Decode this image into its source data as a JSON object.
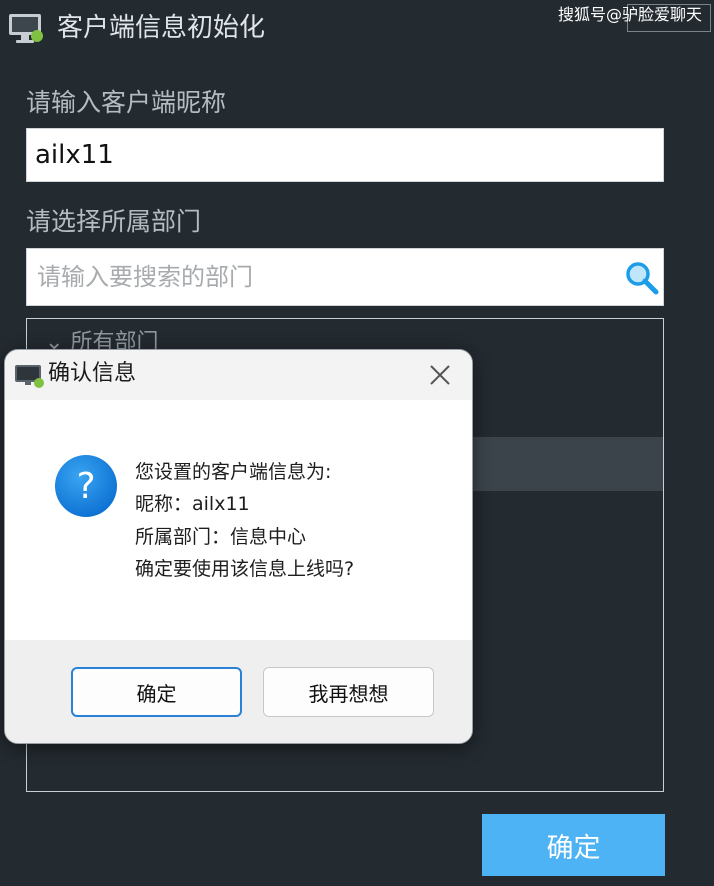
{
  "window": {
    "title": "客户端信息初始化",
    "watermark": "搜狐号@驴脸爱聊天"
  },
  "form": {
    "nickname_label": "请输入客户端昵称",
    "nickname_value": "ailx11",
    "department_label": "请选择所属部门",
    "search_placeholder": "请输入要搜索的部门",
    "tree_root": "所有部门",
    "ok_button": "确定"
  },
  "dialog": {
    "title": "确认信息",
    "lines": [
      "您设置的客户端信息为:",
      "昵称：ailx11",
      "所属部门：信息中心",
      "确定要使用该信息上线吗?"
    ],
    "confirm_button": "确定",
    "rethink_button": "我再想想"
  },
  "colors": {
    "background": "#232a30",
    "accent": "#4db3f4",
    "dialog_focus_border": "#2a82d6"
  },
  "icons": {
    "title": "monitor-icon",
    "search": "search-icon",
    "dialog": "monitor-icon",
    "close": "close-icon",
    "question": "question-icon",
    "tree": "chevron-down-icon"
  }
}
